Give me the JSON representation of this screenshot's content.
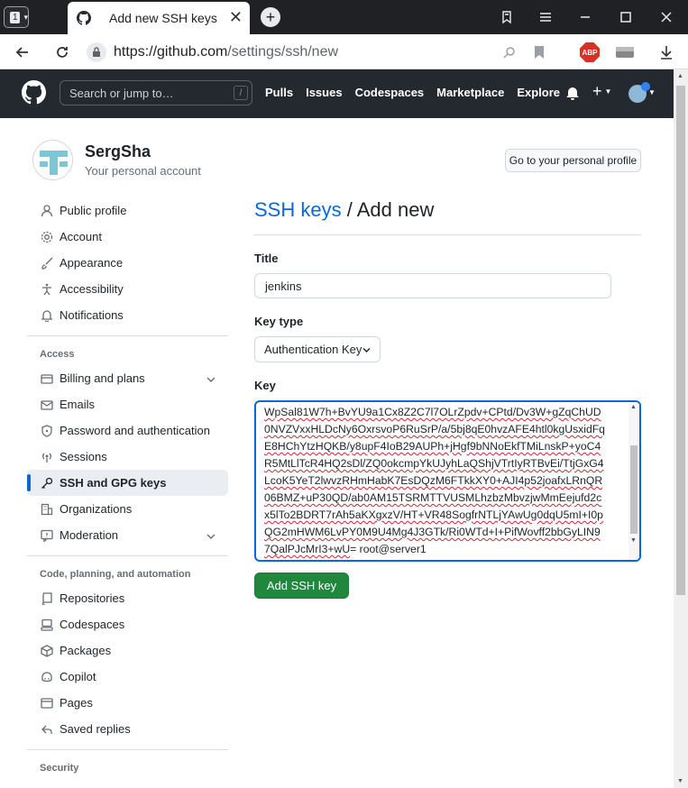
{
  "browser": {
    "tab_count": "1",
    "tab_title": "Add new SSH keys",
    "url_host": "https://github.com",
    "url_path": "/settings/ssh/new",
    "abp_label": "ABP"
  },
  "gh_header": {
    "search_placeholder": "Search or jump to…",
    "search_shortcut": "/",
    "nav": [
      "Pulls",
      "Issues",
      "Codespaces",
      "Marketplace",
      "Explore"
    ]
  },
  "profile": {
    "name": "SergSha",
    "subtitle": "Your personal account",
    "profile_button": "Go to your personal profile"
  },
  "sidebar": {
    "top_items": [
      {
        "label": "Public profile",
        "icon": "person-icon"
      },
      {
        "label": "Account",
        "icon": "gear-icon"
      },
      {
        "label": "Appearance",
        "icon": "paintbrush-icon"
      },
      {
        "label": "Accessibility",
        "icon": "accessibility-icon"
      },
      {
        "label": "Notifications",
        "icon": "bell-icon"
      }
    ],
    "access_heading": "Access",
    "access_items": [
      {
        "label": "Billing and plans",
        "icon": "credit-card-icon",
        "expandable": true
      },
      {
        "label": "Emails",
        "icon": "mail-icon"
      },
      {
        "label": "Password and authentication",
        "icon": "shield-lock-icon"
      },
      {
        "label": "Sessions",
        "icon": "broadcast-icon"
      },
      {
        "label": "SSH and GPG keys",
        "icon": "key-icon",
        "active": true
      },
      {
        "label": "Organizations",
        "icon": "organization-icon"
      },
      {
        "label": "Moderation",
        "icon": "report-icon",
        "expandable": true
      }
    ],
    "code_heading": "Code, planning, and automation",
    "code_items": [
      {
        "label": "Repositories",
        "icon": "repo-icon"
      },
      {
        "label": "Codespaces",
        "icon": "codespaces-icon"
      },
      {
        "label": "Packages",
        "icon": "package-icon"
      },
      {
        "label": "Copilot",
        "icon": "copilot-icon"
      },
      {
        "label": "Pages",
        "icon": "browser-icon"
      },
      {
        "label": "Saved replies",
        "icon": "reply-icon"
      }
    ],
    "security_heading": "Security"
  },
  "main": {
    "title_link": "SSH keys",
    "title_rest": " / Add new",
    "title_label": "Title",
    "title_value": "jenkins",
    "key_type_label": "Key type",
    "key_type_value": "Authentication Key",
    "key_label": "Key",
    "key_lines": [
      "WpSal81W7h+BvYU9a1Cx8Z2C7l7OLrZpdv+CPtd/Dv3W+gZqChUD",
      "0NVZVxxHLDcNy6OxrsvoP6RuSrP/a/5bj8qE0hvzAFE4htl0kgUsxidFq",
      "E8HChYtzHQKB/y8upF4IoB29AUPh+jHgf9bNNoEkfTMiLnskP+yoC4",
      "R5MtLlTcR4HQ2sDl/ZQ0okcmpYkUJyhLaQShjVTrtIyRTBvEi/TtjGxG4",
      "LcoK5YeT2lwvzRHmHabK7EsDQzM6FTkkXY0+AJI4p52joafxLRnQR",
      "06BMZ+uP30QD/ab0AM15TSRMTTVUSMLhzbzMbvzjwMmEejufd2c",
      "x5lTo2BDRT7rAh5aKXgxzV/HT+VR48SogfrNTLjYAwUg0dqU5mI+I0p",
      "QG2mHWM6LvPY0M9U4Mg4J3GTk/Ri0WTd+I+PifWovff2bbGyLIN9",
      "7QalPJcMrI3+wU"
    ],
    "key_last_suffix": "= root@server1",
    "submit_label": "Add SSH key"
  }
}
